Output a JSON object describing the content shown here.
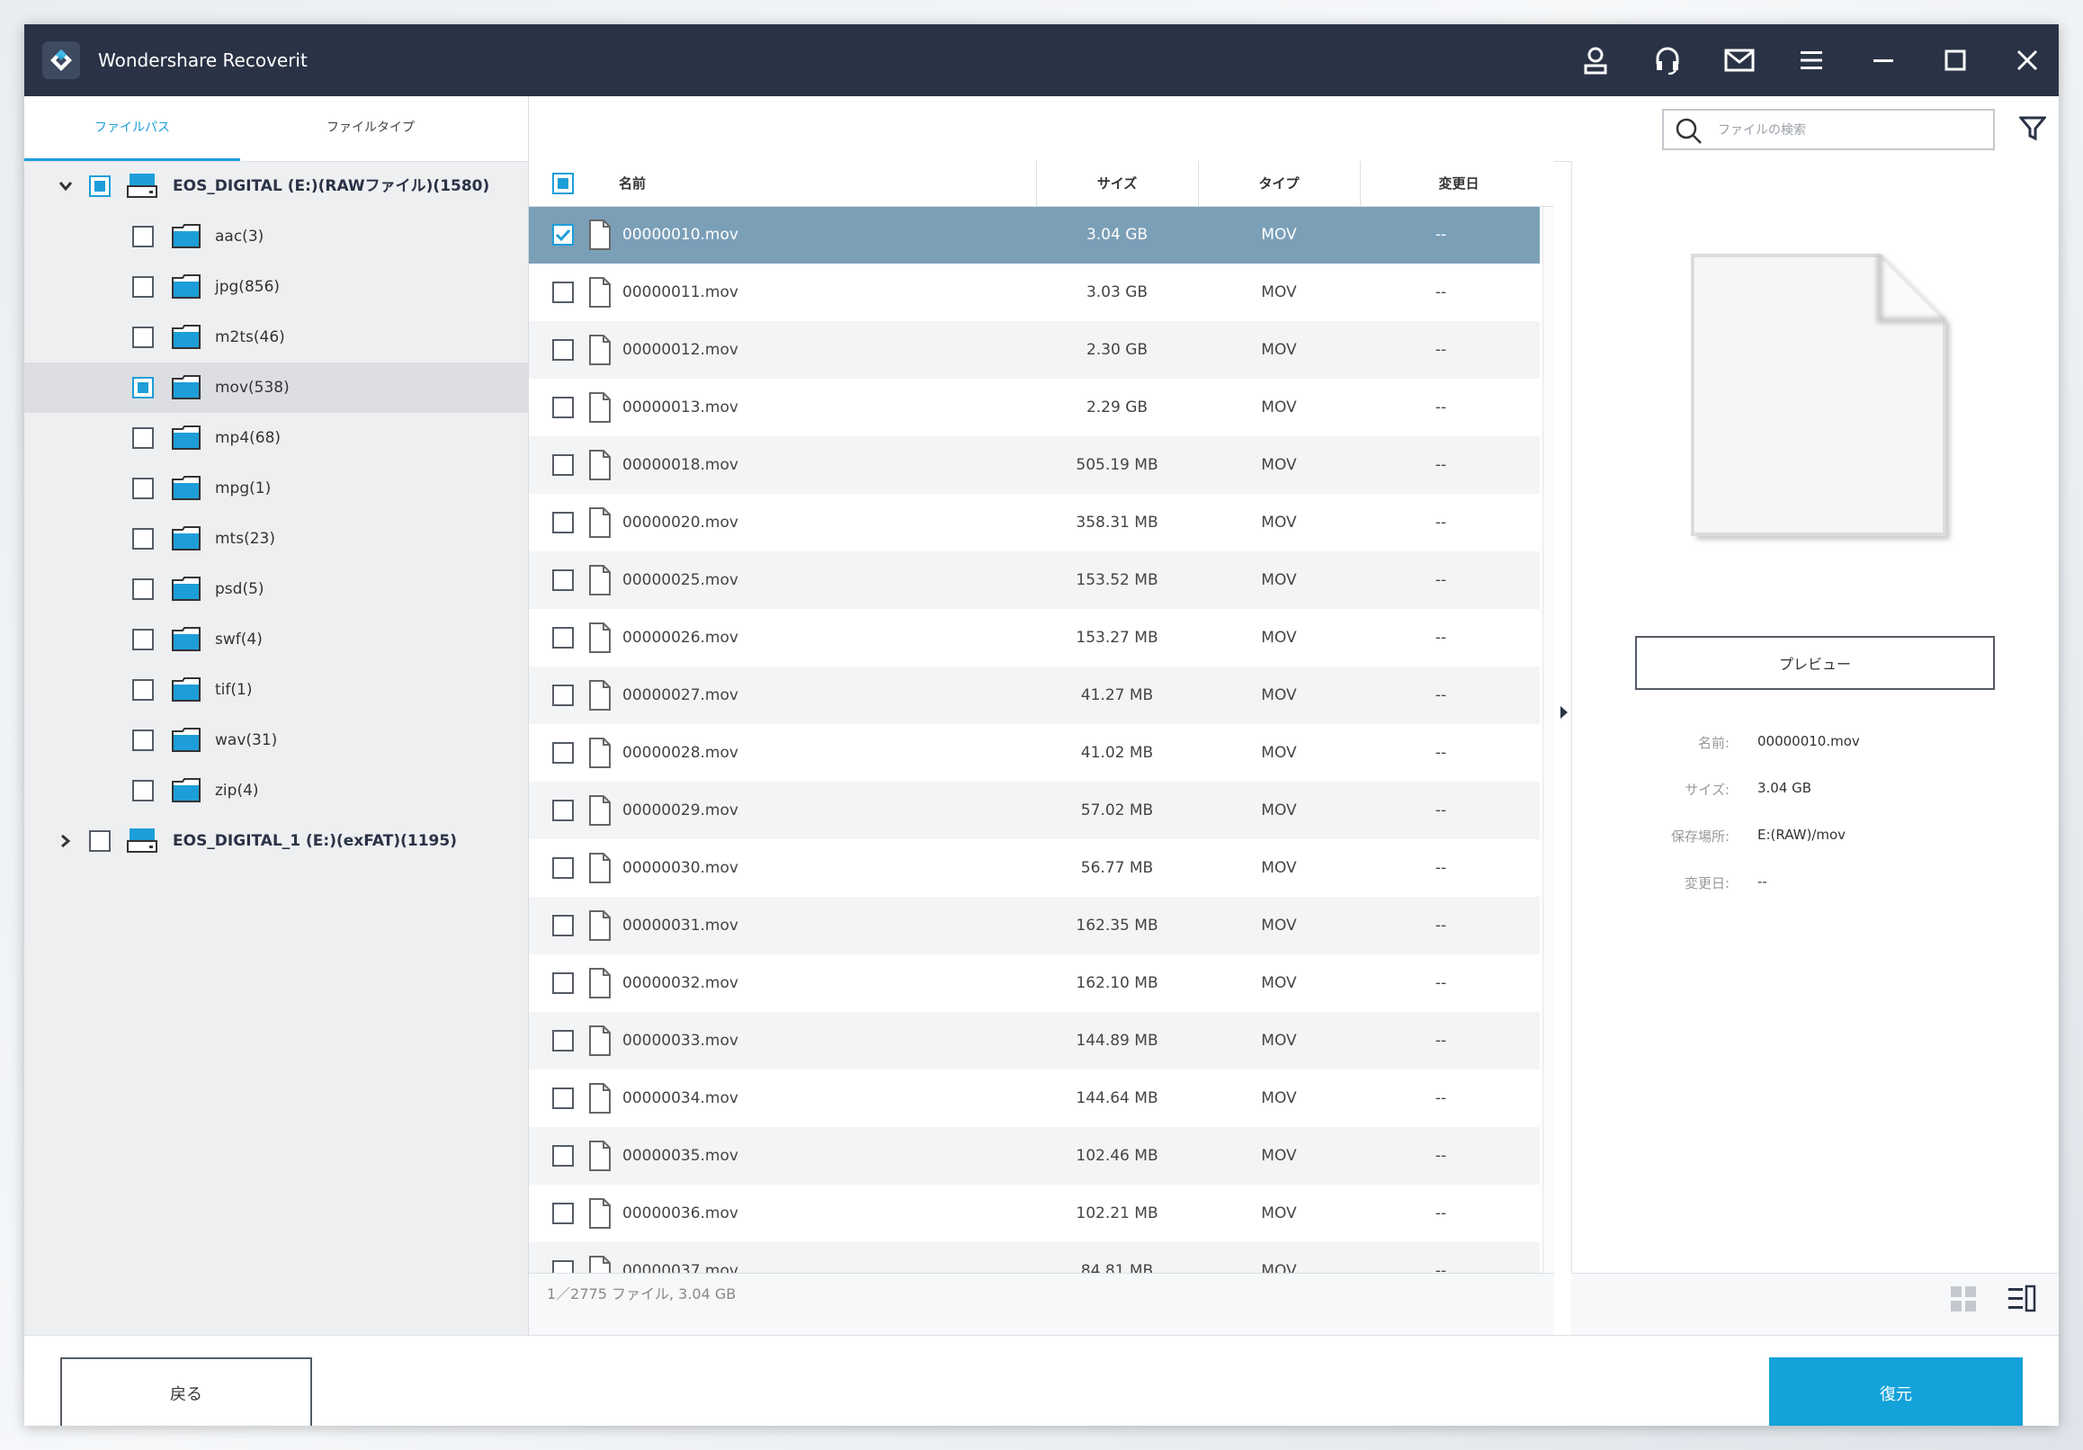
{
  "app": {
    "title": "Wondershare Recoverit"
  },
  "tabs": [
    {
      "label": "ファイルパス",
      "active": true
    },
    {
      "label": "ファイルタイプ",
      "active": false
    }
  ],
  "tree": {
    "drive1": {
      "label": "EOS_DIGITAL (E:)(RAWファイル)(1580)",
      "expanded": true,
      "state": "partial"
    },
    "folders": [
      {
        "label": "aac(3)",
        "checked": false
      },
      {
        "label": "jpg(856)",
        "checked": false
      },
      {
        "label": "m2ts(46)",
        "checked": false
      },
      {
        "label": "mov(538)",
        "checked": "partial",
        "selected": true
      },
      {
        "label": "mp4(68)",
        "checked": false
      },
      {
        "label": "mpg(1)",
        "checked": false
      },
      {
        "label": "mts(23)",
        "checked": false
      },
      {
        "label": "psd(5)",
        "checked": false
      },
      {
        "label": "swf(4)",
        "checked": false
      },
      {
        "label": "tif(1)",
        "checked": false
      },
      {
        "label": "wav(31)",
        "checked": false
      },
      {
        "label": "zip(4)",
        "checked": false
      }
    ],
    "drive2": {
      "label": "EOS_DIGITAL_1 (E:)(exFAT)(1195)",
      "expanded": false,
      "state": "unchecked"
    }
  },
  "search": {
    "placeholder": "ファイルの検索",
    "value": ""
  },
  "list": {
    "headers": {
      "name": "名前",
      "size": "サイズ",
      "type": "タイプ",
      "modified": "変更日"
    },
    "rows": [
      {
        "name": "00000010.mov",
        "size": "3.04 GB",
        "type": "MOV",
        "modified": "--",
        "checked": true,
        "selected": true
      },
      {
        "name": "00000011.mov",
        "size": "3.03 GB",
        "type": "MOV",
        "modified": "--",
        "checked": false
      },
      {
        "name": "00000012.mov",
        "size": "2.30 GB",
        "type": "MOV",
        "modified": "--",
        "checked": false
      },
      {
        "name": "00000013.mov",
        "size": "2.29 GB",
        "type": "MOV",
        "modified": "--",
        "checked": false
      },
      {
        "name": "00000018.mov",
        "size": "505.19 MB",
        "type": "MOV",
        "modified": "--",
        "checked": false
      },
      {
        "name": "00000020.mov",
        "size": "358.31 MB",
        "type": "MOV",
        "modified": "--",
        "checked": false
      },
      {
        "name": "00000025.mov",
        "size": "153.52 MB",
        "type": "MOV",
        "modified": "--",
        "checked": false
      },
      {
        "name": "00000026.mov",
        "size": "153.27 MB",
        "type": "MOV",
        "modified": "--",
        "checked": false
      },
      {
        "name": "00000027.mov",
        "size": "41.27 MB",
        "type": "MOV",
        "modified": "--",
        "checked": false
      },
      {
        "name": "00000028.mov",
        "size": "41.02 MB",
        "type": "MOV",
        "modified": "--",
        "checked": false
      },
      {
        "name": "00000029.mov",
        "size": "57.02 MB",
        "type": "MOV",
        "modified": "--",
        "checked": false
      },
      {
        "name": "00000030.mov",
        "size": "56.77 MB",
        "type": "MOV",
        "modified": "--",
        "checked": false
      },
      {
        "name": "00000031.mov",
        "size": "162.35 MB",
        "type": "MOV",
        "modified": "--",
        "checked": false
      },
      {
        "name": "00000032.mov",
        "size": "162.10 MB",
        "type": "MOV",
        "modified": "--",
        "checked": false
      },
      {
        "name": "00000033.mov",
        "size": "144.89 MB",
        "type": "MOV",
        "modified": "--",
        "checked": false
      },
      {
        "name": "00000034.mov",
        "size": "144.64 MB",
        "type": "MOV",
        "modified": "--",
        "checked": false
      },
      {
        "name": "00000035.mov",
        "size": "102.46 MB",
        "type": "MOV",
        "modified": "--",
        "checked": false
      },
      {
        "name": "00000036.mov",
        "size": "102.21 MB",
        "type": "MOV",
        "modified": "--",
        "checked": false
      },
      {
        "name": "00000037.mov",
        "size": "84.81 MB",
        "type": "MOV",
        "modified": "--",
        "checked": false
      }
    ]
  },
  "status": {
    "text": "1／2775 ファイル, 3.04 GB"
  },
  "preview": {
    "button_label": "プレビュー",
    "info": [
      {
        "key": "名前:",
        "value": "00000010.mov"
      },
      {
        "key": "サイズ:",
        "value": "3.04 GB"
      },
      {
        "key": "保存場所:",
        "value": "E:(RAW)/mov"
      },
      {
        "key": "変更日:",
        "value": "--"
      }
    ]
  },
  "buttons": {
    "back": "戻る",
    "recover": "復元"
  },
  "colors": {
    "titlebar": "#2a3346",
    "accent": "#1d9ed9",
    "selected_row": "#7b9fb7",
    "recover_button": "#13a2da"
  },
  "icons": [
    "logo-icon",
    "account-icon",
    "support-headset-icon",
    "mail-icon",
    "menu-icon",
    "minimize-icon",
    "maximize-icon",
    "close-icon",
    "search-icon",
    "filter-icon",
    "drive-icon",
    "folder-icon",
    "file-icon",
    "grid-view-icon",
    "list-view-icon"
  ]
}
